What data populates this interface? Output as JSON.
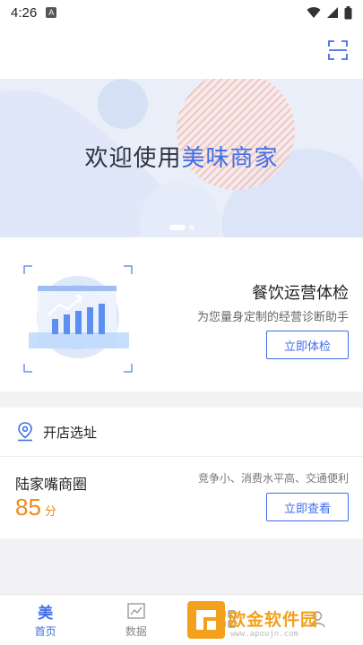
{
  "status_bar": {
    "time": "4:26",
    "badge": "A"
  },
  "banner": {
    "title_prefix": "欢迎使用",
    "title_brand": "美味商家",
    "page_count": 2,
    "active_page": 1
  },
  "health_check": {
    "title": "餐饮运营体检",
    "subtitle": "为您量身定制的经营诊断助手",
    "button": "立即体检"
  },
  "site_selection": {
    "header": "开店选址",
    "area_name": "陆家嘴商圈",
    "score": "85",
    "score_unit": "分",
    "tags": "竞争小、消费水平高、交通便利",
    "button": "立即查看"
  },
  "tabbar": {
    "tabs": [
      {
        "label": "首页",
        "icon_text": "美",
        "icon": "brand-icon",
        "active": true
      },
      {
        "label": "数据",
        "icon": "chart-icon",
        "active": false
      },
      {
        "label": "",
        "icon": "grid-icon",
        "active": false
      },
      {
        "label": "",
        "icon": "user-icon",
        "active": false
      }
    ]
  },
  "watermark": {
    "text": "欧金软件园",
    "url": "www.apoujn.com"
  },
  "colors": {
    "accent": "#3f6ee8",
    "score": "#f08a1a",
    "banner_bg": "#e9eef9"
  }
}
